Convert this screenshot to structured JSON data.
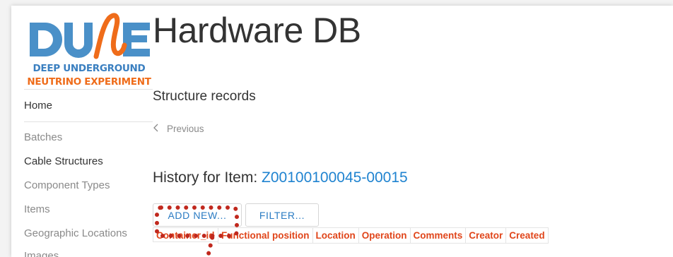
{
  "logo": {
    "wordmark": "DUNE",
    "line1": "DEEP UNDERGROUND",
    "line2": "NEUTRINO EXPERIMENT"
  },
  "sidebar": {
    "items": [
      {
        "label": "Home"
      },
      {
        "label": "Batches"
      },
      {
        "label": "Cable Structures"
      },
      {
        "label": "Component Types"
      },
      {
        "label": "Items"
      },
      {
        "label": "Geographic Locations"
      },
      {
        "label": "Images"
      }
    ]
  },
  "header": {
    "title": "Hardware DB"
  },
  "main": {
    "subtitle": "Structure records",
    "previous_label": "Previous",
    "previous_icon": "chevron-left-icon",
    "history_prefix": "History for Item: ",
    "item_id": "Z00100100045-00015",
    "buttons": {
      "add_new": "ADD NEW...",
      "filter": "FILTER..."
    },
    "table": {
      "columns": [
        "Container_id",
        "Functional position",
        "Location",
        "Operation",
        "Comments",
        "Creator",
        "Created"
      ]
    }
  },
  "colors": {
    "accent_blue": "#1f83d0",
    "header_orange": "#e0451a",
    "annotation_red": "#c0281d",
    "logo_blue": "#3a7fc0",
    "logo_orange": "#ef6c1a"
  }
}
